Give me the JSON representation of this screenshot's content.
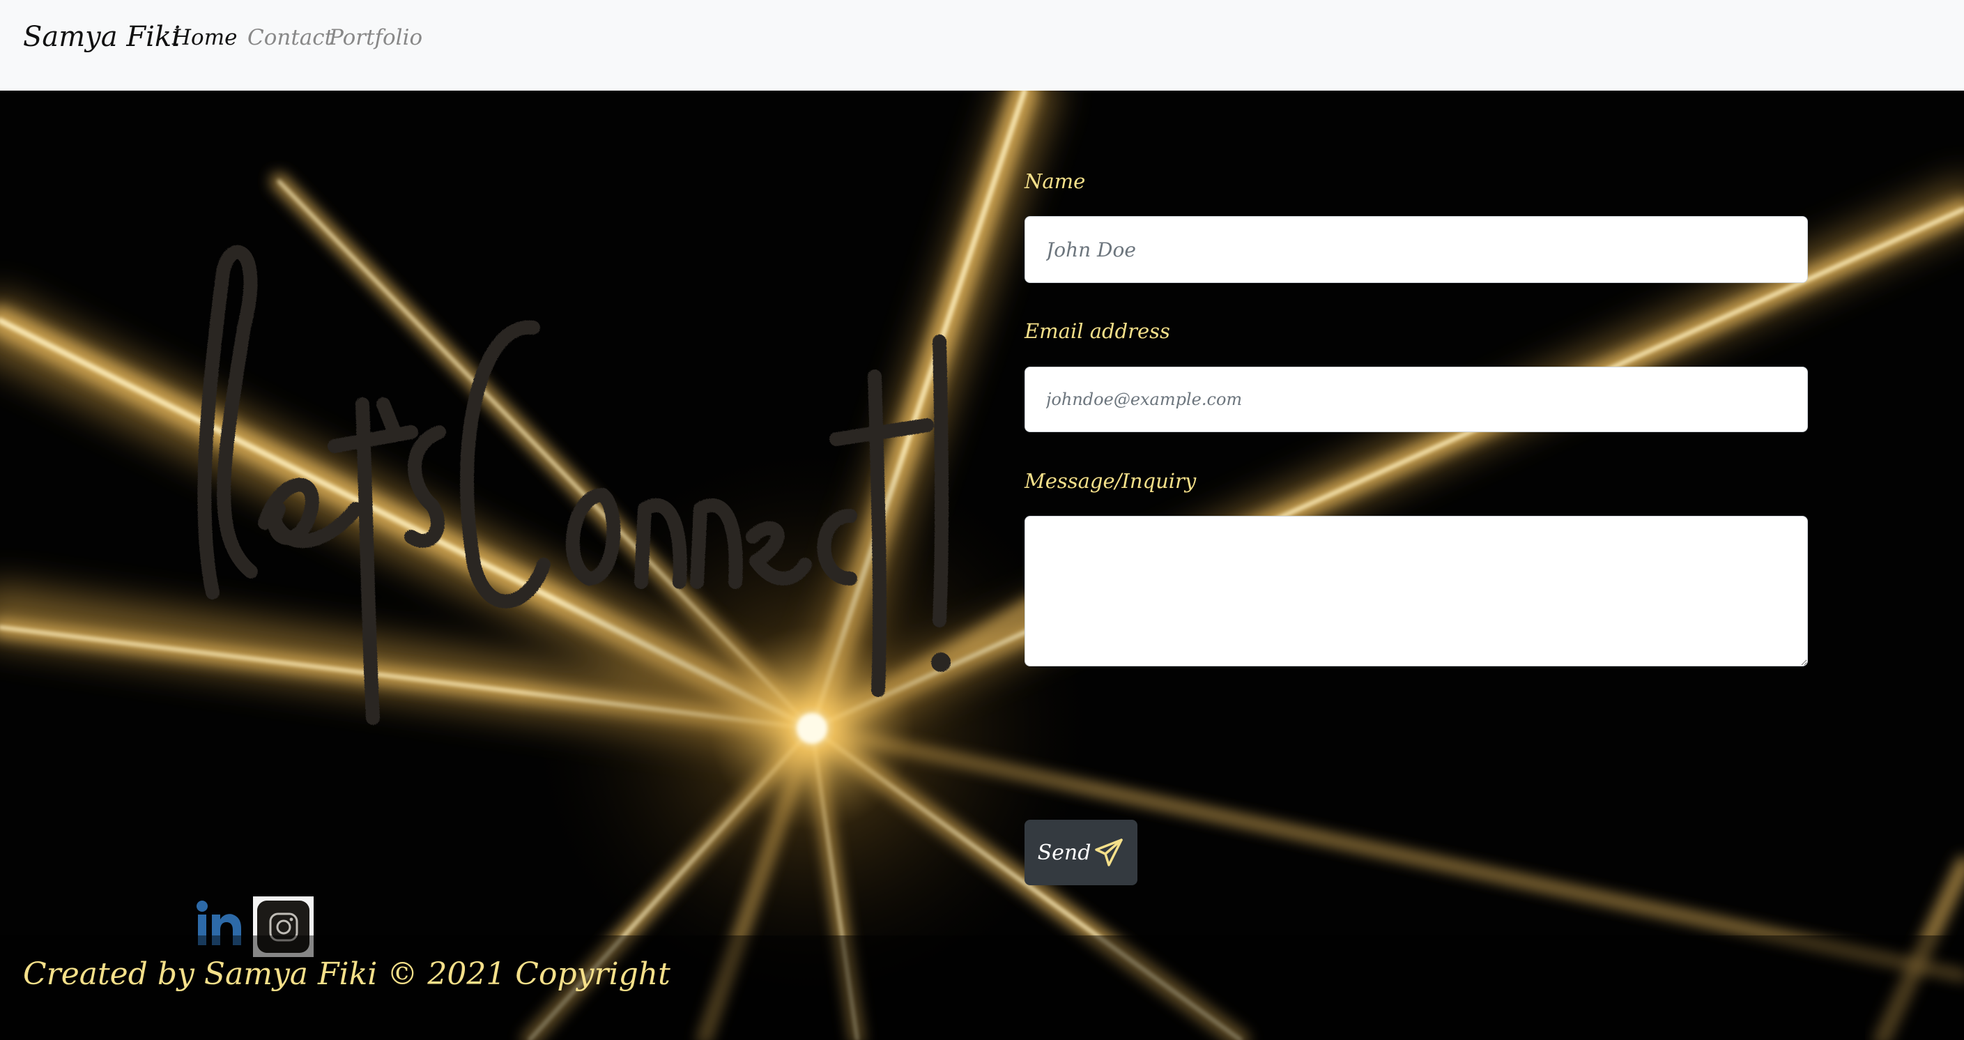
{
  "navbar": {
    "brand": "Samya Fiki",
    "links": [
      {
        "label": "Home",
        "active": true
      },
      {
        "label": "Contact",
        "active": false
      },
      {
        "label": "Portfolio",
        "active": false
      }
    ]
  },
  "hero": {
    "script_text": "let's Connect!"
  },
  "form": {
    "name_label": "Name",
    "name_placeholder": "John Doe",
    "email_label": "Email address",
    "email_placeholder": "johndoe@example.com",
    "message_label": "Message/Inquiry",
    "message_placeholder": "",
    "send_label": "Send",
    "send_icon": "paper-plane-icon"
  },
  "social": {
    "linkedin_icon": "linkedin-icon",
    "instagram_icon": "instagram-icon"
  },
  "footer": {
    "text": "Created by Samya Fiki © 2021 Copyright"
  },
  "colors": {
    "accent": "#f5e08a",
    "navbar_bg": "#f8f9fa",
    "button_bg": "#343a40",
    "linkedin_blue": "#2d6aa8",
    "background": "#020202"
  }
}
